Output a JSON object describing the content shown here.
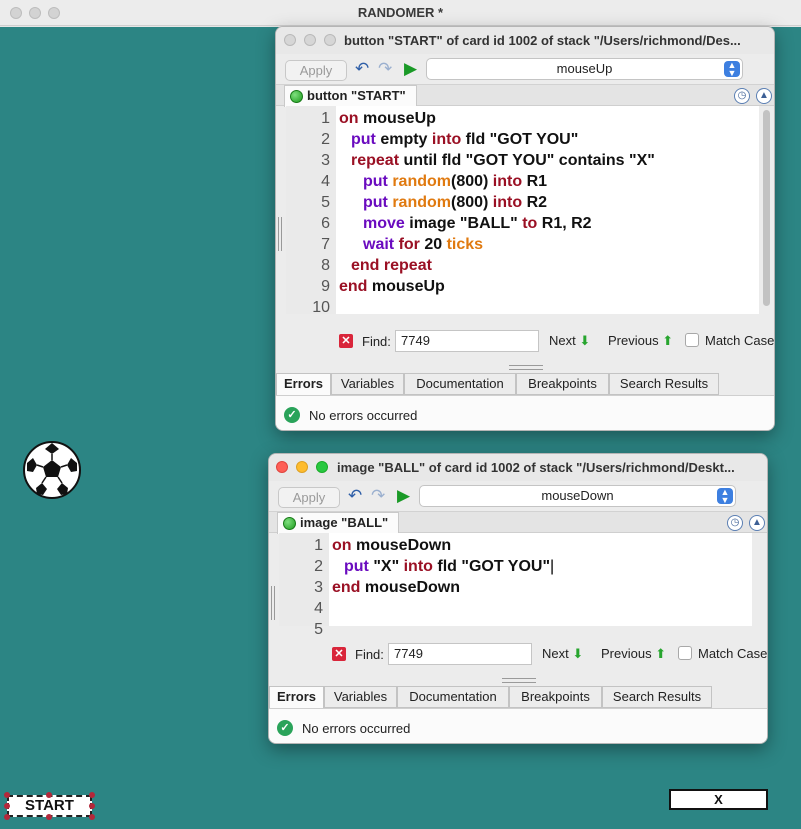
{
  "main_window": {
    "title": "RANDOMER *"
  },
  "editor1": {
    "title": "button \"START\" of card id 1002 of stack \"/Users/richmond/Des...",
    "apply_label": "Apply",
    "handler": "mouseUp",
    "script_tab": "button \"START\"",
    "line_numbers": [
      "1",
      "2",
      "3",
      "4",
      "5",
      "6",
      "7",
      "8",
      "9",
      "10"
    ],
    "find_label": "Find:",
    "find_value": "7749",
    "next_label": "Next",
    "previous_label": "Previous",
    "match_case_label": "Match Case",
    "tabs": [
      "Errors",
      "Variables",
      "Documentation",
      "Breakpoints",
      "Search Results"
    ],
    "status": "No errors occurred"
  },
  "editor2": {
    "title": "image \"BALL\" of card id 1002 of stack \"/Users/richmond/Deskt...",
    "apply_label": "Apply",
    "handler": "mouseDown",
    "script_tab": "image \"BALL\"",
    "line_numbers": [
      "1",
      "2",
      "3",
      "4",
      "5"
    ],
    "find_label": "Find:",
    "find_value": "7749",
    "next_label": "Next",
    "previous_label": "Previous",
    "match_case_label": "Match Case",
    "tabs": [
      "Errors",
      "Variables",
      "Documentation",
      "Breakpoints",
      "Search Results"
    ],
    "status": "No errors occurred"
  },
  "code1": {
    "l1": [
      "on",
      " mouseUp"
    ],
    "l2": [
      "put",
      " empty ",
      "into",
      " fld \"GOT YOU\""
    ],
    "l3": [
      "repeat",
      " until fld \"GOT YOU\" contains \"X\""
    ],
    "l4": [
      "put",
      " ",
      "random",
      "(800) ",
      "into",
      " R1"
    ],
    "l5": [
      "put",
      " ",
      "random",
      "(800) ",
      "into",
      " R2"
    ],
    "l6": [
      "move",
      " image \"BALL\" ",
      "to",
      " R1, R2"
    ],
    "l7": [
      "wait",
      " ",
      "for",
      " 20 ",
      "ticks"
    ],
    "l8": [
      "end repeat"
    ],
    "l9": [
      "end",
      " mouseUp"
    ]
  },
  "code2": {
    "l1": [
      "on",
      " mouseDown"
    ],
    "l2": [
      "put",
      " \"X\" ",
      "into",
      " fld \"GOT YOU\""
    ],
    "l3": [
      "end",
      " mouseDown"
    ]
  },
  "card": {
    "start_label": "START",
    "field_value": "X"
  }
}
